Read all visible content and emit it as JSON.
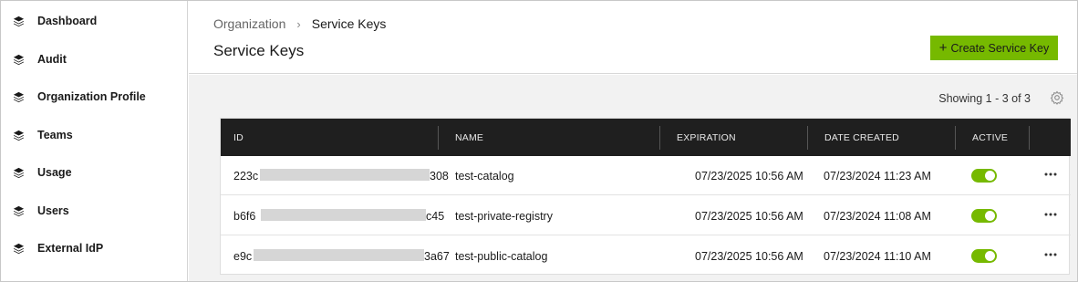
{
  "sidebar": {
    "items": [
      {
        "label": "Dashboard",
        "icon": "layers-icon"
      },
      {
        "label": "Audit",
        "icon": "layers-icon"
      },
      {
        "label": "Organization Profile",
        "icon": "layers-icon"
      },
      {
        "label": "Teams",
        "icon": "layers-icon"
      },
      {
        "label": "Usage",
        "icon": "layers-icon"
      },
      {
        "label": "Users",
        "icon": "layers-icon"
      },
      {
        "label": "External IdP",
        "icon": "layers-icon"
      }
    ]
  },
  "breadcrumb": {
    "parent": "Organization",
    "separator": "›",
    "current": "Service Keys"
  },
  "page": {
    "title": "Service Keys",
    "create_button": "Create Service Key",
    "create_icon": "+"
  },
  "list": {
    "showing": "Showing 1 - 3 of 3",
    "settings_icon": "gear-icon"
  },
  "table": {
    "headers": {
      "id": "ID",
      "name": "NAME",
      "expiration": "EXPIRATION",
      "date_created": "DATE CREATED",
      "active": "ACTIVE"
    },
    "rows": [
      {
        "id_prefix": "223c",
        "id_suffix": "308",
        "name": "test-catalog",
        "expiration": "07/23/2025 10:56 AM",
        "date_created": "07/23/2024 11:23 AM",
        "active": true
      },
      {
        "id_prefix": "b6f6",
        "id_suffix": "c45",
        "name": "test-private-registry",
        "expiration": "07/23/2025 10:56 AM",
        "date_created": "07/23/2024 11:08 AM",
        "active": true
      },
      {
        "id_prefix": "e9c",
        "id_suffix": "3a67",
        "name": "test-public-catalog",
        "expiration": "07/23/2025 10:56 AM",
        "date_created": "07/23/2024 11:10 AM",
        "active": true
      }
    ]
  },
  "colors": {
    "accent": "#76b900",
    "header_bg": "#1f1f1f",
    "content_bg": "#f2f2f2"
  }
}
